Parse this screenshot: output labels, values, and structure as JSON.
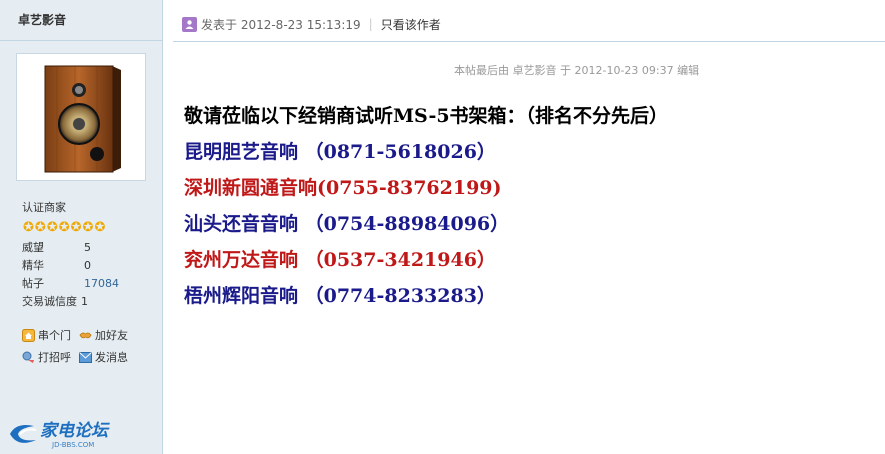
{
  "author": {
    "name": "卓艺影音",
    "badge": "认证商家",
    "star_count": 7,
    "stats": [
      {
        "key": "威望",
        "value": "5"
      },
      {
        "key": "精华",
        "value": "0"
      },
      {
        "key": "帖子",
        "value": "17084"
      },
      {
        "key": "交易诚信度",
        "value": "1"
      }
    ],
    "actions": {
      "visit": "串个门",
      "add_friend": "加好友",
      "poke": "打招呼",
      "message": "发消息"
    }
  },
  "forum_logo": {
    "name": "家电论坛",
    "domain": "JD-BBS.COM"
  },
  "post": {
    "posted_at": "发表于 2012-8-23 15:13:19",
    "only_author": "只看该作者",
    "edit_note": "本帖最后由 卓艺影音 于 2012-10-23 09:37 编辑",
    "lines": [
      {
        "text": "敬请莅临以下经销商试听MS-5书架箱：（排名不分先后）",
        "style": "title"
      },
      {
        "text": "昆明胆艺音响 （0871-5618026）",
        "style": "blue"
      },
      {
        "text": "深圳新圆通音响(0755-83762199)",
        "style": "red"
      },
      {
        "text": "汕头还音音响 （0754-88984096）",
        "style": "blue"
      },
      {
        "text": "兖州万达音响 （0537-3421946）",
        "style": "red"
      },
      {
        "text": "梧州辉阳音响 （0774-8233283）",
        "style": "blue"
      }
    ]
  },
  "colors": {
    "sidebar_bg": "#e5edf2",
    "border": "#c2d5e3",
    "text_blue": "#1a1a8a",
    "text_red": "#c01818",
    "star": "#f0a800"
  }
}
